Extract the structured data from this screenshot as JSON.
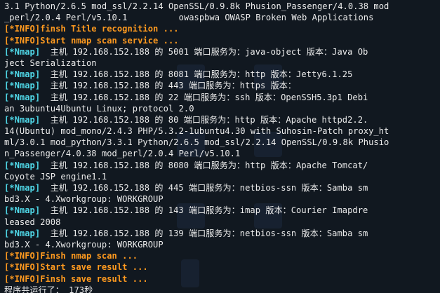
{
  "colors": {
    "background": "#111820",
    "info": "#ff9a1f",
    "nmap": "#4fd6e6",
    "text": "#ececec"
  },
  "lines": [
    {
      "text": "3.1 Python/2.6.5 mod_ssl/2.2.14 OpenSSL/0.9.8k Phusion_Passenger/4.0.38 mod"
    },
    {
      "text": "_perl/2.0.4 Perl/v5.10.1          owaspbwa OWASP Broken Web Applications"
    },
    {
      "tag": "[*INFO]",
      "text": "finsh Title recognition ..."
    },
    {
      "tag": "[*INFO]",
      "text": "Start nmap scan service ..."
    },
    {
      "tag": "[*Nmap]",
      "text": "  主机 192.168.152.188 的 5001 端口服务为：java-object 版本：Java Ob"
    },
    {
      "text": "ject Serialization"
    },
    {
      "tag": "[*Nmap]",
      "text": "  主机 192.168.152.188 的 8081 端口服务为：http 版本：Jetty6.1.25"
    },
    {
      "tag": "[*Nmap]",
      "text": "  主机 192.168.152.188 的 443 端口服务为：https 版本："
    },
    {
      "tag": "[*Nmap]",
      "text": "  主机 192.168.152.188 的 22 端口服务为：ssh 版本：OpenSSH5.3p1 Debi"
    },
    {
      "text": "an 3ubuntu4Ubuntu Linux; protocol 2.0"
    },
    {
      "tag": "[*Nmap]",
      "text": "  主机 192.168.152.188 的 80 端口服务为：http 版本：Apache httpd2.2."
    },
    {
      "text": "14(Ubuntu) mod_mono/2.4.3 PHP/5.3.2-1ubuntu4.30 with Suhosin-Patch proxy_ht"
    },
    {
      "text": "ml/3.0.1 mod_python/3.3.1 Python/2.6.5 mod_ssl/2.2.14 OpenSSL/0.9.8k Phusio"
    },
    {
      "text": "n_Passenger/4.0.38 mod_perl/2.0.4 Perl/v5.10.1"
    },
    {
      "tag": "[*Nmap]",
      "text": "  主机 192.168.152.188 的 8080 端口服务为：http 版本：Apache Tomcat/"
    },
    {
      "text": "Coyote JSP engine1.1"
    },
    {
      "tag": "[*Nmap]",
      "text": "  主机 192.168.152.188 的 445 端口服务为：netbios-ssn 版本：Samba sm"
    },
    {
      "text": "bd3.X - 4.Xworkgroup: WORKGROUP"
    },
    {
      "tag": "[*Nmap]",
      "text": "  主机 192.168.152.188 的 143 端口服务为：imap 版本：Courier Imapdre"
    },
    {
      "text": "leased 2008"
    },
    {
      "tag": "[*Nmap]",
      "text": "  主机 192.168.152.188 的 139 端口服务为：netbios-ssn 版本：Samba sm"
    },
    {
      "text": "bd3.X - 4.Xworkgroup: WORKGROUP"
    },
    {
      "tag": "[*INFO]",
      "text": "Finsh nmap scan ..."
    },
    {
      "tag": "[*INFO]",
      "text": "Start save result ..."
    },
    {
      "tag": "[*INFO]",
      "text": "Finsh save result ..."
    },
    {
      "text": "程序共运行了： 173秒"
    }
  ]
}
